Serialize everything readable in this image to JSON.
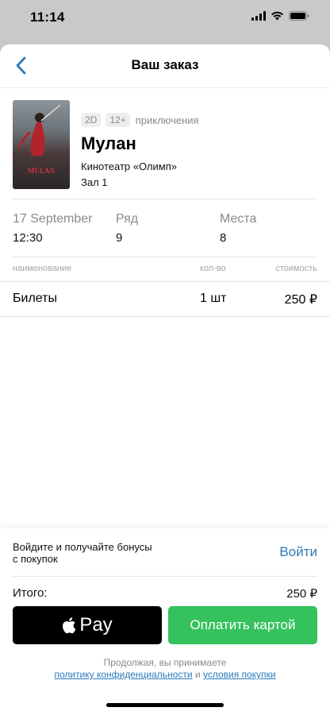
{
  "status_bar": {
    "time": "11:14"
  },
  "nav": {
    "title": "Ваш заказ"
  },
  "movie": {
    "format": "2D",
    "age": "12+",
    "genre": "приключения",
    "title": "Мулан",
    "cinema": "Кинотеатр «Олимп»",
    "hall": "Зал 1",
    "poster_label": "MULAN"
  },
  "session": {
    "date": "17 September",
    "time": "12:30",
    "row_label": "Ряд",
    "row_value": "9",
    "seats_label": "Места",
    "seats_value": "8"
  },
  "table": {
    "headers": {
      "name": "наименование",
      "qty": "кол-во",
      "cost": "стоимость"
    },
    "rows": [
      {
        "name": "Билеты",
        "qty": "1 шт",
        "cost": "250 ₽"
      }
    ]
  },
  "footer": {
    "bonus_line1": "Войдите и получайте бонусы",
    "bonus_line2": "с покупок",
    "login_label": "Войти",
    "total_label": "Итого:",
    "total_value": "250 ₽",
    "apple_pay_label": "Pay",
    "card_pay_label": "Оплатить картой",
    "terms_prefix": "Продолжая, вы принимаете",
    "privacy_link": "политику конфиденциальности",
    "terms_and": "и",
    "purchase_link": "условия покупки"
  },
  "colors": {
    "accent": "#2d79b9",
    "pay_green": "#35c25c"
  }
}
